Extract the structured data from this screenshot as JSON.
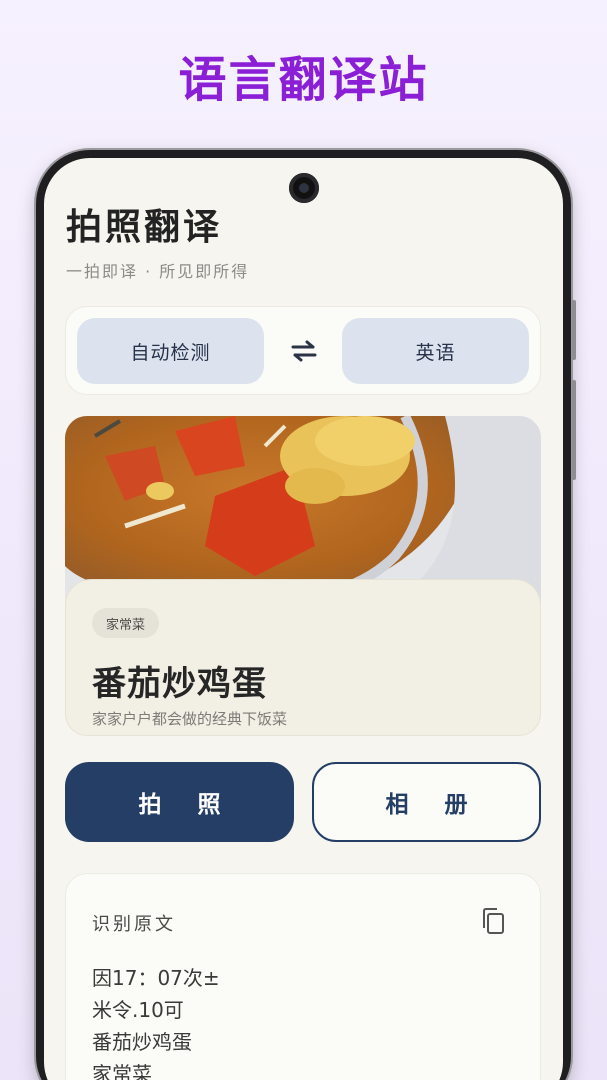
{
  "promo": {
    "title": "语言翻译站"
  },
  "app": {
    "title": "拍照翻译",
    "subtitle": "一拍即译 · 所见即所得"
  },
  "language_bar": {
    "source": "自动检测",
    "target": "英语",
    "swap_icon": "swap-arrows-icon"
  },
  "dish_card": {
    "tag": "家常菜",
    "name": "番茄炒鸡蛋",
    "description": "家家户户都会做的经典下饭菜"
  },
  "actions": {
    "capture": "拍 照",
    "album": "相 册"
  },
  "ocr": {
    "title": "识别原文",
    "copy_icon": "copy-icon",
    "lines": [
      "因17：07次±",
      "米令.10可",
      "番茄炒鸡蛋",
      "家常菜"
    ]
  },
  "colors": {
    "promo_accent": "#8a1fd6",
    "primary": "#253e66",
    "lang_chip": "#dde3ee",
    "background": "#f6f5ef"
  }
}
